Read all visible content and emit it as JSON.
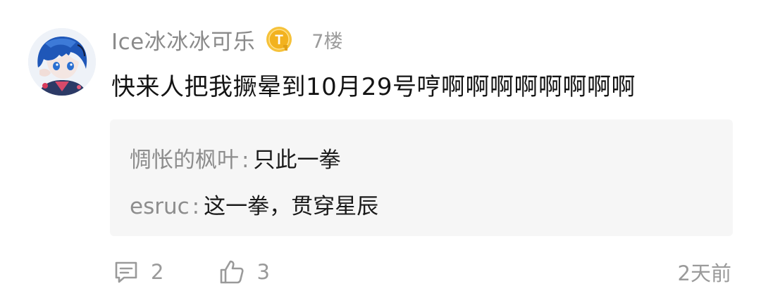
{
  "comment": {
    "username": "Ice冰冰冰可乐",
    "level_badge_letter": "T",
    "floor": "7楼",
    "text": "快来人把我撅晕到10月29号哼啊啊啊啊啊啊啊啊",
    "replies": [
      {
        "author": "惆怅的枫叶",
        "separator": ":",
        "text": "只此一拳"
      },
      {
        "author": "esruc",
        "separator": ":",
        "text": "这一拳，贯穿星辰"
      }
    ],
    "actions": {
      "reply_icon": "comment-icon",
      "reply_count": "2",
      "like_icon": "thumbs-up-icon",
      "like_count": "3"
    },
    "timestamp": "2天前"
  },
  "colors": {
    "background": "#ffffff",
    "reply_box": "#f6f6f6",
    "muted_text": "#8a8a8a",
    "main_text": "#141414",
    "badge_gold": "#f2b21e"
  }
}
